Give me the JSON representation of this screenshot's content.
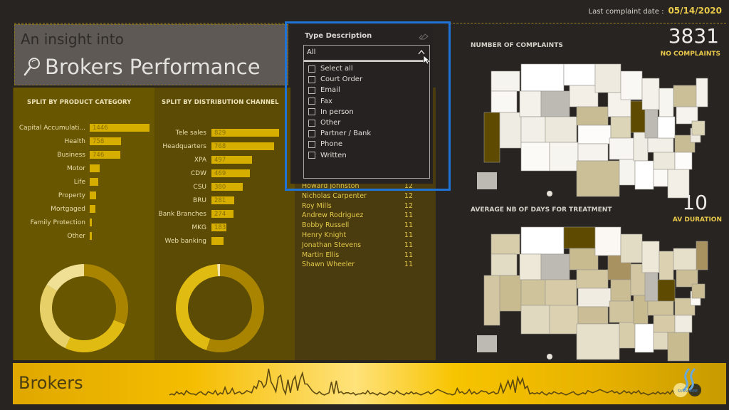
{
  "header": {
    "last_complaint_label": "Last complaint date :",
    "last_complaint_value": "05/14/2020"
  },
  "title": {
    "small": "An insight into",
    "big": "Brokers Performance",
    "icon": "magnifier-icon"
  },
  "product_category": {
    "title": "SPLIT BY PRODUCT CATEGORY",
    "items": [
      {
        "label": "Capital Accumulati...",
        "value": 1446,
        "show_value": true
      },
      {
        "label": "Health",
        "value": 758,
        "show_value": true
      },
      {
        "label": "Business",
        "value": 746,
        "show_value": true
      },
      {
        "label": "Motor",
        "value": 240,
        "show_value": false
      },
      {
        "label": "Life",
        "value": 215,
        "show_value": false
      },
      {
        "label": "Property",
        "value": 150,
        "show_value": false
      },
      {
        "label": "Mortgaged",
        "value": 140,
        "show_value": false
      },
      {
        "label": "Family Protection",
        "value": 40,
        "show_value": false
      },
      {
        "label": "Other",
        "value": 35,
        "show_value": false
      }
    ],
    "donut": [
      {
        "name": "segment-1",
        "share": 0.31,
        "color": "#a88400"
      },
      {
        "name": "segment-2",
        "share": 0.26,
        "color": "#e0bb12"
      },
      {
        "name": "segment-3",
        "share": 0.27,
        "color": "#e8d068"
      },
      {
        "name": "segment-4",
        "share": 0.16,
        "color": "#f0e096"
      }
    ]
  },
  "distribution_channel": {
    "title": "SPLIT BY DISTRIBUTION CHANNEL",
    "items": [
      {
        "label": "Tele sales",
        "value": 829,
        "show_value": true
      },
      {
        "label": "Headquarters",
        "value": 768,
        "show_value": true
      },
      {
        "label": "XPA",
        "value": 497,
        "show_value": true
      },
      {
        "label": "CDW",
        "value": 469,
        "show_value": true
      },
      {
        "label": "CSU",
        "value": 380,
        "show_value": true
      },
      {
        "label": "BRU",
        "value": 281,
        "show_value": true
      },
      {
        "label": "Bank Branches",
        "value": 274,
        "show_value": true
      },
      {
        "label": "MKG",
        "value": 183,
        "show_value": true
      },
      {
        "label": "Web banking",
        "value": 150,
        "show_value": false
      }
    ],
    "donut": [
      {
        "name": "segment-1",
        "share": 0.55,
        "color": "#a88400"
      },
      {
        "name": "segment-2",
        "share": 0.44,
        "color": "#e0bb12"
      },
      {
        "name": "segment-3",
        "share": 0.01,
        "color": "#f4e8b0"
      }
    ]
  },
  "brokers_list": {
    "rows": [
      {
        "name": "Howard Johnston",
        "value": "12"
      },
      {
        "name": "Nicholas Carpenter",
        "value": "12"
      },
      {
        "name": "Roy Mills",
        "value": "12"
      },
      {
        "name": "Andrew Rodriguez",
        "value": "11"
      },
      {
        "name": "Bobby Russell",
        "value": "11"
      },
      {
        "name": "Henry Knight",
        "value": "11"
      },
      {
        "name": "Jonathan Stevens",
        "value": "11"
      },
      {
        "name": "Martin Ellis",
        "value": "11"
      },
      {
        "name": "Shawn Wheeler",
        "value": "11"
      }
    ]
  },
  "slicer": {
    "title": "Type Description",
    "selected": "All",
    "options": [
      "Select all",
      "Court Order",
      "Email",
      "Fax",
      "In person",
      "Other",
      "Partner / Bank",
      "Phone",
      "Written"
    ]
  },
  "complaints": {
    "title": "NUMBER OF COMPLAINTS",
    "kpi_value": "3831",
    "kpi_label": "NO COMPLAINTS"
  },
  "duration": {
    "title": "AVERAGE NB OF DAYS FOR TREATMENT",
    "kpi_value": "10",
    "kpi_label": "AV DURATION"
  },
  "footer": {
    "label": "Brokers",
    "logo_text": "SUBSCRIBE",
    "sparkline": [
      2,
      3,
      2,
      5,
      3,
      4,
      2,
      6,
      4,
      3,
      3,
      2,
      4,
      5,
      3,
      2,
      5,
      4,
      3,
      6,
      2,
      4,
      3,
      9,
      3,
      4,
      8,
      3,
      4,
      5,
      3,
      4,
      6,
      5,
      4,
      10,
      8,
      15,
      14,
      9,
      12,
      26,
      14,
      10,
      5,
      18,
      20,
      8,
      3,
      16,
      4,
      15,
      19,
      6,
      16,
      22,
      12,
      12,
      9,
      6,
      4,
      3,
      5,
      3,
      2,
      3,
      4,
      14,
      3,
      15,
      4,
      5,
      3,
      4,
      4,
      3,
      4,
      2,
      3,
      3,
      4,
      3,
      6,
      3,
      4,
      3,
      2,
      4,
      3,
      2,
      3,
      5,
      4,
      3,
      6,
      4,
      3,
      2,
      4,
      3,
      5,
      3,
      4,
      3,
      2,
      3,
      4,
      5,
      3,
      4,
      6,
      7,
      6,
      5,
      4,
      3,
      3,
      2,
      3,
      8,
      4,
      5,
      3,
      4,
      7,
      3,
      5,
      3,
      4,
      6,
      5,
      5,
      3,
      4,
      5,
      3,
      4,
      12,
      4,
      9,
      15,
      8,
      16,
      4,
      18,
      12,
      17,
      8,
      10,
      3,
      4,
      3,
      4,
      3,
      5,
      3,
      2,
      4,
      3,
      5,
      4,
      3,
      4,
      3,
      2,
      3,
      4,
      5,
      3,
      2,
      3,
      4,
      3,
      6,
      5,
      4,
      5,
      6,
      7,
      6,
      5,
      4,
      5,
      6,
      4,
      5,
      3,
      4,
      6,
      4,
      5,
      3,
      5,
      4,
      6,
      3,
      4,
      3,
      2,
      3,
      4,
      3,
      5,
      3,
      4,
      3,
      5,
      3,
      6,
      3
    ]
  }
}
